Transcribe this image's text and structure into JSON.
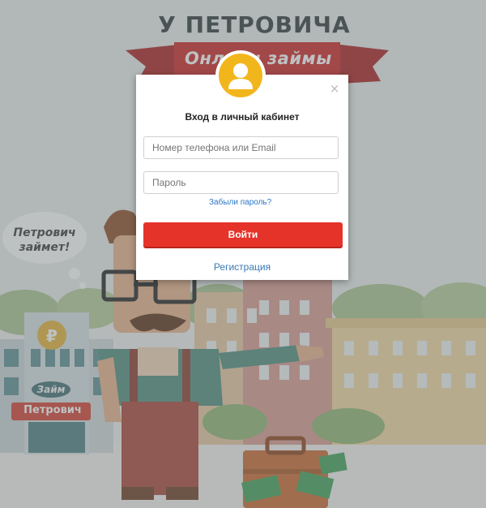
{
  "background": {
    "header_title": "У ПЕТРОВИЧА",
    "ribbon_text": "Онлайн займы",
    "speech_bubble_line1": "Петрович",
    "speech_bubble_line2": "займет!",
    "building_badge": "Займ",
    "building_sign": "Петрович"
  },
  "modal": {
    "title": "Вход в личный кабинет",
    "close_symbol": "×",
    "phone_placeholder": "Номер телефона или Email",
    "phone_value": "",
    "password_placeholder": "Пароль",
    "password_value": "",
    "forgot_label": "Забыли пароль?",
    "login_label": "Войти",
    "register_label": "Регистрация",
    "avatar_icon": "user-icon"
  },
  "colors": {
    "accent_red": "#e5332a",
    "avatar_yellow": "#f2b61d",
    "link_blue": "#2b77c7"
  }
}
